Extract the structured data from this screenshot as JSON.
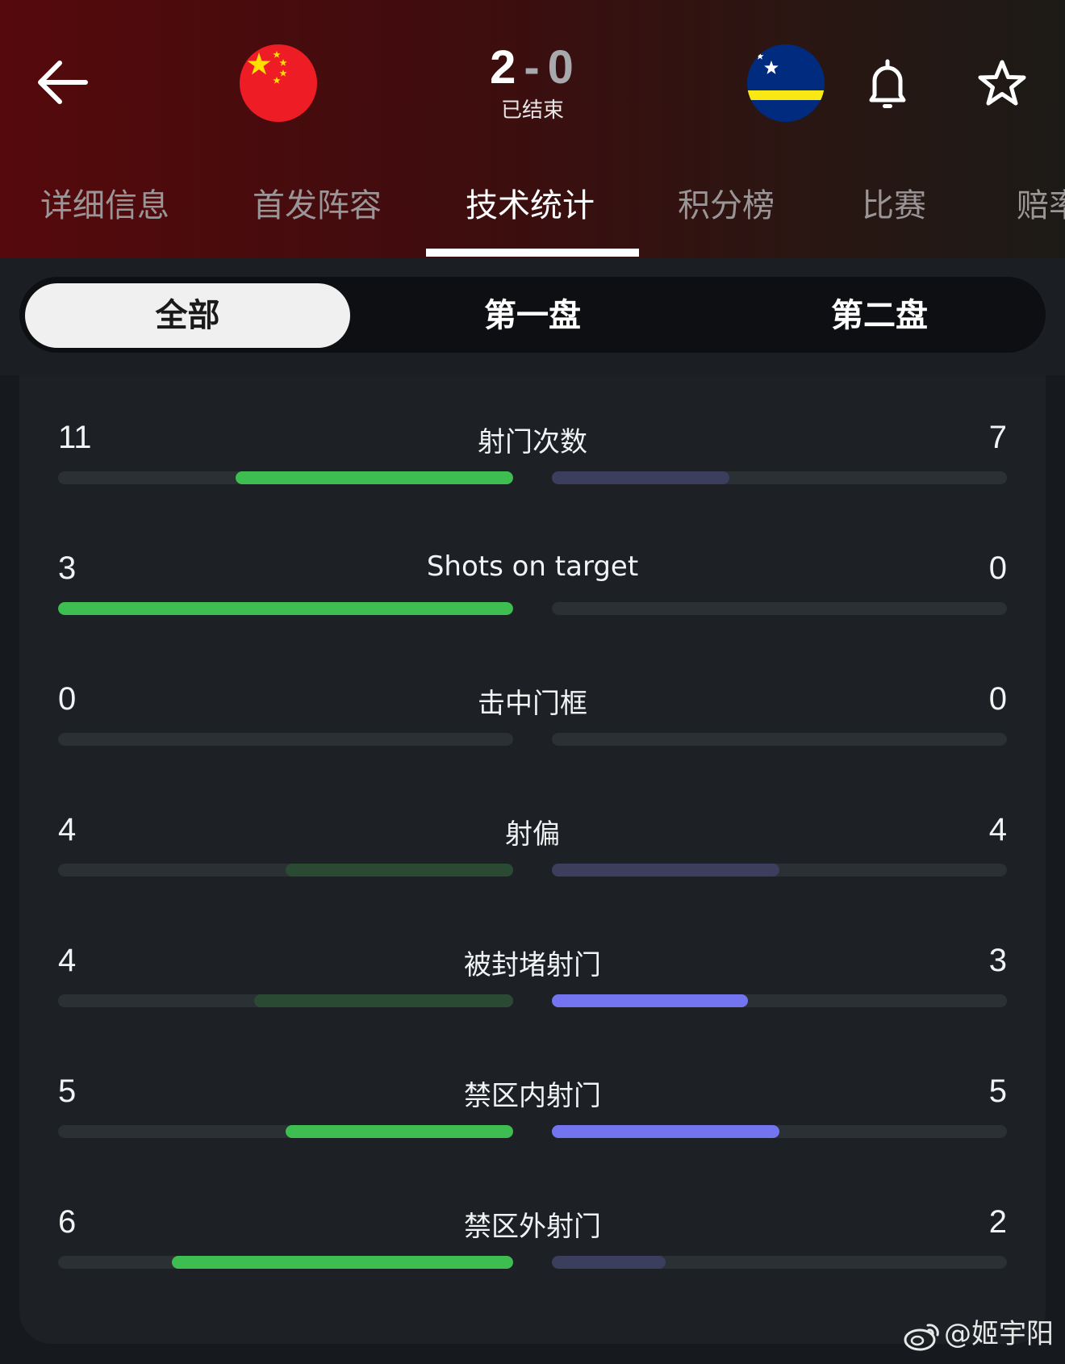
{
  "match": {
    "home_score": "2",
    "separator": "-",
    "away_score": "0",
    "status": "已结束"
  },
  "header_icons": {
    "back": "arrow-left-icon",
    "home_flag": "china-flag-icon",
    "away_flag": "curacao-flag-icon",
    "bell": "bell-icon",
    "star": "star-icon"
  },
  "tabs": [
    {
      "label": "详细信息"
    },
    {
      "label": "首发阵容"
    },
    {
      "label": "技术统计",
      "active": true
    },
    {
      "label": "积分榜"
    },
    {
      "label": "比赛"
    },
    {
      "label": "赔率"
    }
  ],
  "period_filter": [
    {
      "label": "全部",
      "active": true
    },
    {
      "label": "第一盘"
    },
    {
      "label": "第二盘"
    }
  ],
  "colors": {
    "home_highlight": "#3ebd50",
    "home_dim": "#2b4a33",
    "away_highlight": "#7375f0",
    "away_dim": "#3b3e5c",
    "track": "#2b3034"
  },
  "stats": [
    {
      "label": "射门次数",
      "home": "11",
      "away": "7",
      "home_ratio": 0.61,
      "away_ratio": 0.39,
      "home_style": "highlight",
      "away_style": "dim"
    },
    {
      "label": "Shots on target",
      "home": "3",
      "away": "0",
      "home_ratio": 1.0,
      "away_ratio": 0.0,
      "home_style": "highlight",
      "away_style": "dim"
    },
    {
      "label": "击中门框",
      "home": "0",
      "away": "0",
      "home_ratio": 0.0,
      "away_ratio": 0.0,
      "home_style": "dim",
      "away_style": "dim"
    },
    {
      "label": "射偏",
      "home": "4",
      "away": "4",
      "home_ratio": 0.5,
      "away_ratio": 0.5,
      "home_style": "dim",
      "away_style": "dim"
    },
    {
      "label": "被封堵射门",
      "home": "4",
      "away": "3",
      "home_ratio": 0.57,
      "away_ratio": 0.43,
      "home_style": "dim",
      "away_style": "highlight"
    },
    {
      "label": "禁区内射门",
      "home": "5",
      "away": "5",
      "home_ratio": 0.5,
      "away_ratio": 0.5,
      "home_style": "highlight",
      "away_style": "highlight"
    },
    {
      "label": "禁区外射门",
      "home": "6",
      "away": "2",
      "home_ratio": 0.75,
      "away_ratio": 0.25,
      "home_style": "highlight",
      "away_style": "dim"
    }
  ],
  "watermark": "@姬宇阳"
}
